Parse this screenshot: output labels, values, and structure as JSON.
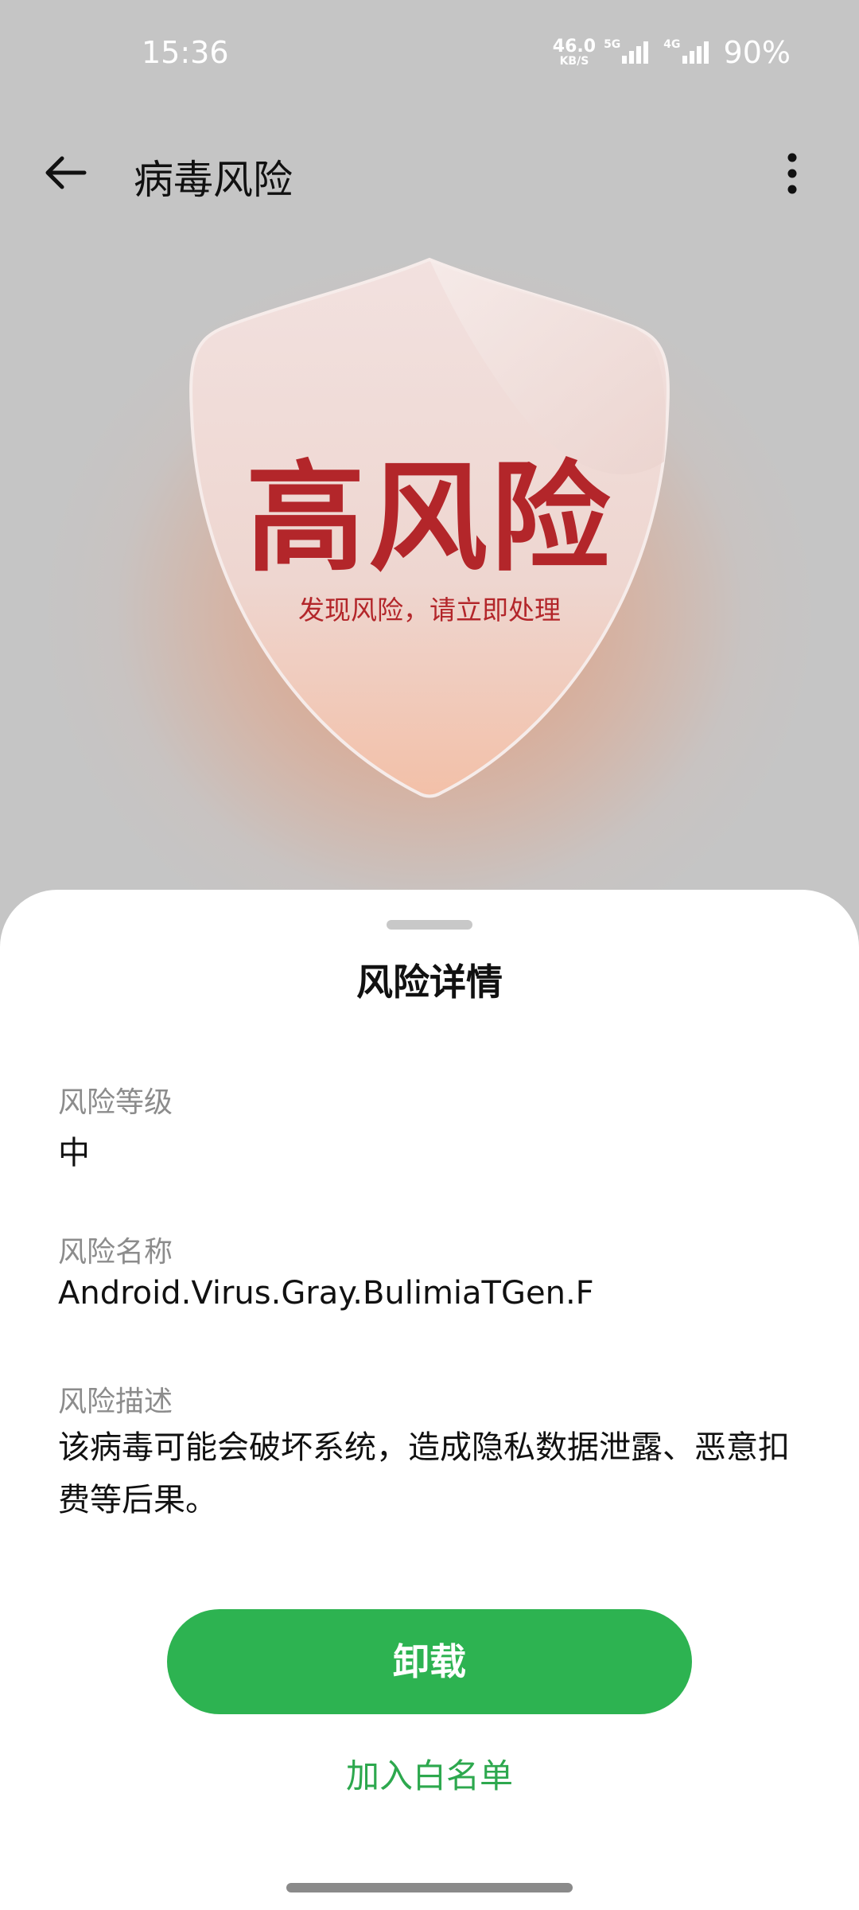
{
  "status_bar": {
    "time": "15:36",
    "net_speed_value": "46.0",
    "net_speed_unit": "KB/S",
    "sim1_type": "5G",
    "sim2_type": "4G",
    "battery": "90%"
  },
  "app_bar": {
    "title": "病毒风险",
    "back_icon": "arrow-left-icon",
    "more_icon": "more-vertical-icon"
  },
  "hero": {
    "risk_level": "高风险",
    "message": "发现风险，请立即处理",
    "risk_color": "#b3262a"
  },
  "sheet": {
    "title": "风险详情",
    "fields": [
      {
        "label": "风险等级",
        "value": "中"
      },
      {
        "label": "风险名称",
        "value": "Android.Virus.Gray.BulimiaTGen.F"
      },
      {
        "label": "风险描述",
        "value": "该病毒可能会破坏系统，造成隐私数据泄露、恶意扣费等后果。"
      }
    ],
    "primary_button": "卸载",
    "secondary_link": "加入白名单",
    "accent_color": "#2db351"
  }
}
